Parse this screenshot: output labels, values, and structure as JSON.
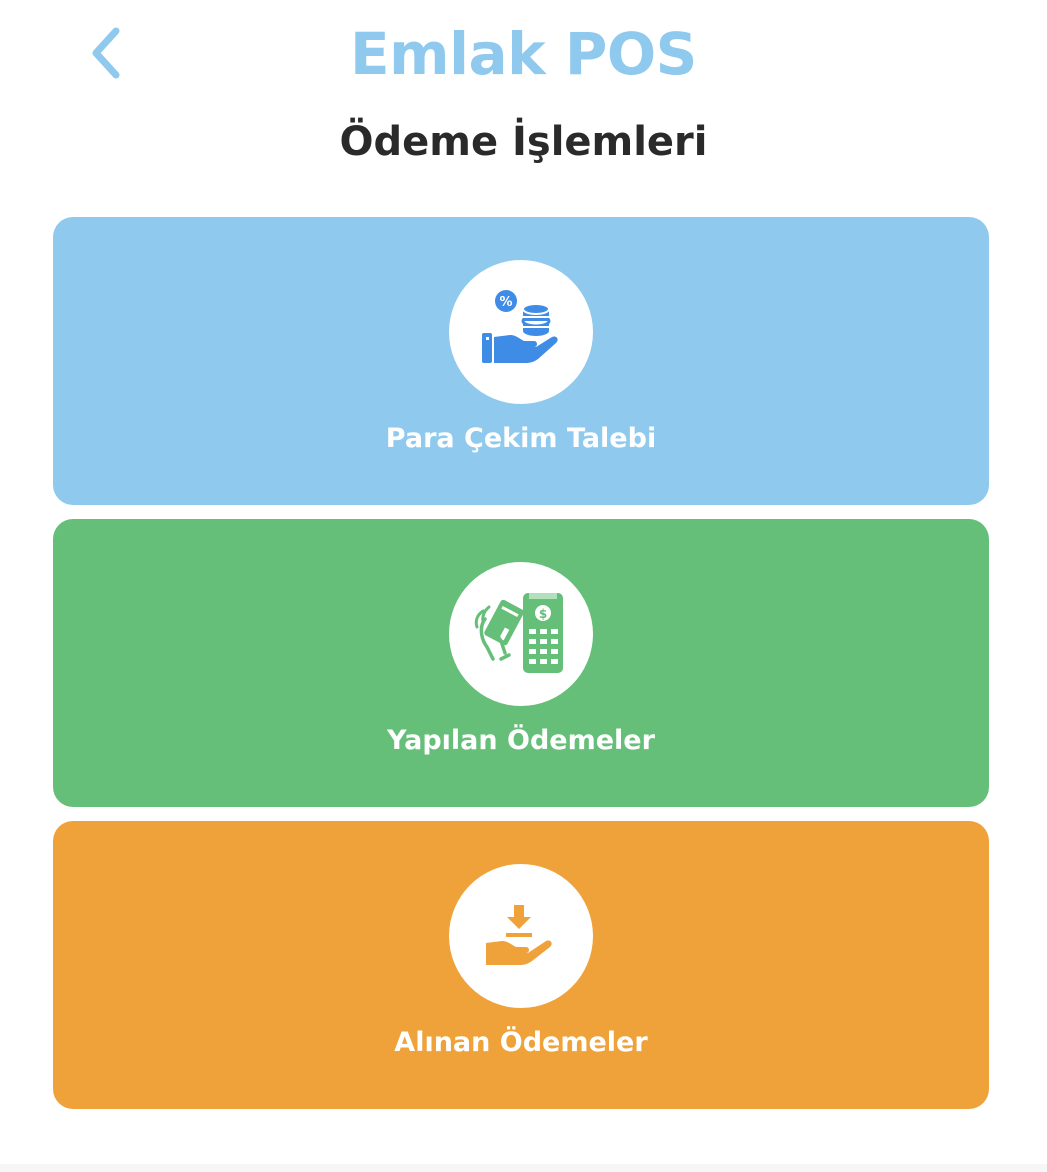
{
  "header": {
    "back_icon": "chevron-left-icon",
    "app_title": "Emlak POS",
    "page_title": "Ödeme İşlemleri"
  },
  "cards": [
    {
      "label": "Para Çekim Talebi",
      "icon": "hand-coins-icon",
      "color": "#8fcaee"
    },
    {
      "label": "Yapılan Ödemeler",
      "icon": "card-payment-terminal-icon",
      "color": "#65bf79"
    },
    {
      "label": "Alınan Ödemeler",
      "icon": "hand-receive-icon",
      "color": "#eea239"
    }
  ],
  "colors": {
    "accent": "#8fcaee",
    "blue_icon": "#3f8ce6",
    "green_icon": "#65bf79",
    "orange_icon": "#eea239"
  }
}
